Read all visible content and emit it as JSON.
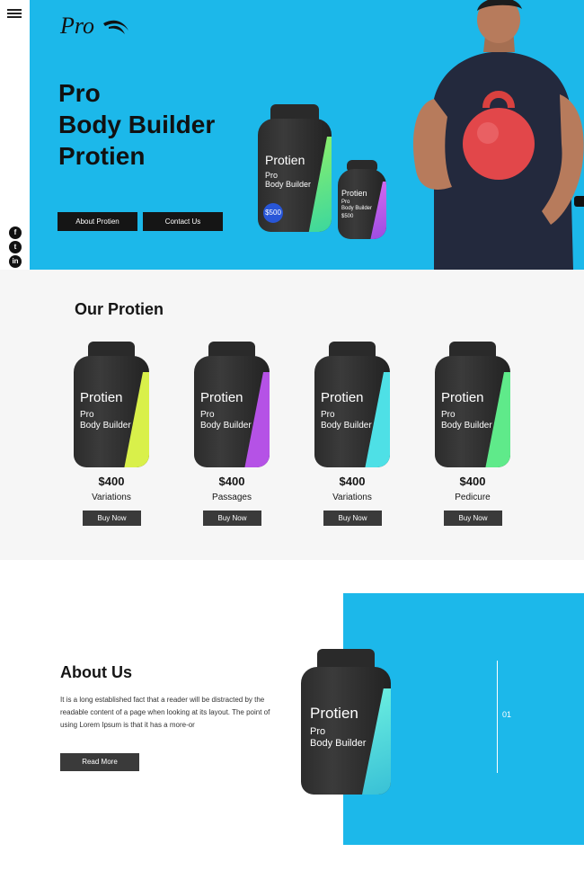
{
  "brand": {
    "logo_text": "Pro"
  },
  "social": [
    {
      "icon": "facebook-icon",
      "glyph": "f"
    },
    {
      "icon": "twitter-icon",
      "glyph": "t"
    },
    {
      "icon": "linkedin-icon",
      "glyph": "in"
    }
  ],
  "hero": {
    "title_line1": "Pro",
    "title_line2": "Body Builder",
    "title_line3": "Protien",
    "about_button": "About Protien",
    "contact_button": "Contact Us",
    "jar_big": {
      "brand": "Protien",
      "line1": "Pro",
      "line2": "Body Builder",
      "price": "$500"
    },
    "jar_small": {
      "brand": "Protien",
      "line1": "Pro",
      "line2": "Body Builder",
      "price": "$500"
    }
  },
  "products": {
    "title": "Our Protien",
    "items": [
      {
        "brand": "Protien",
        "line1": "Pro",
        "line2": "Body Builder",
        "price": "$400",
        "name": "Variations",
        "button": "Buy Now",
        "accent": "#d9f04a"
      },
      {
        "brand": "Protien",
        "line1": "Pro",
        "line2": "Body Builder",
        "price": "$400",
        "name": "Passages",
        "button": "Buy Now",
        "accent": "#b552e6"
      },
      {
        "brand": "Protien",
        "line1": "Pro",
        "line2": "Body Builder",
        "price": "$400",
        "name": "Variations",
        "button": "Buy Now",
        "accent": "#4ee0e6"
      },
      {
        "brand": "Protien",
        "line1": "Pro",
        "line2": "Body Builder",
        "price": "$400",
        "name": "Pedicure",
        "button": "Buy Now",
        "accent": "#5fea8a"
      }
    ]
  },
  "about": {
    "title": "About Us",
    "text": "It is a long established fact that a reader will be distracted by the readable content of a page when looking at its layout. The point of using Lorem Ipsum is that it has a more-or",
    "button": "Read More",
    "jar": {
      "brand": "Protien",
      "line1": "Pro",
      "line2": "Body Builder"
    },
    "slide_number": "01"
  },
  "colors": {
    "accent": "#1cb8ea",
    "dark": "#151515"
  }
}
